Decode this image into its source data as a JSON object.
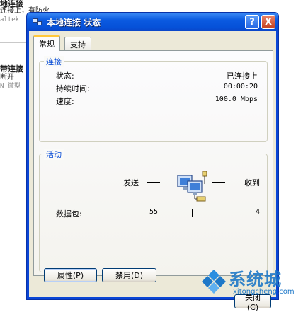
{
  "background": {
    "fragments": [
      "地连接",
      "连接上，有防火",
      "altek",
      "带连接",
      "断开",
      "N 微型"
    ]
  },
  "dialog": {
    "title": "本地连接 状态",
    "title_buttons": {
      "help": "?",
      "close": "X"
    },
    "tabs": [
      {
        "label": "常规",
        "active": true
      },
      {
        "label": "支持",
        "active": false
      }
    ],
    "connection": {
      "group_title": "连接",
      "rows": [
        {
          "label": "状态:",
          "value": "已连接上"
        },
        {
          "label": "持续时间:",
          "value": "00:00:20"
        },
        {
          "label": "速度:",
          "value": "100.0 Mbps"
        }
      ]
    },
    "activity": {
      "group_title": "活动",
      "sent_label": "发送",
      "received_label": "收到",
      "packets_label": "数据包:",
      "packets_sent": "55",
      "packets_received": "4",
      "icon": "network-computers-icon"
    },
    "buttons": {
      "properties": "属性(P)",
      "disable": "禁用(D)",
      "close": "关闭(C)"
    }
  },
  "watermark": {
    "text": "系统城",
    "url": "xitongcheng.com"
  },
  "colors": {
    "titlebar": "#0b5ae0",
    "client": "#ece9d8",
    "group_title": "#0046d5",
    "watermark": "#1e78c8"
  }
}
